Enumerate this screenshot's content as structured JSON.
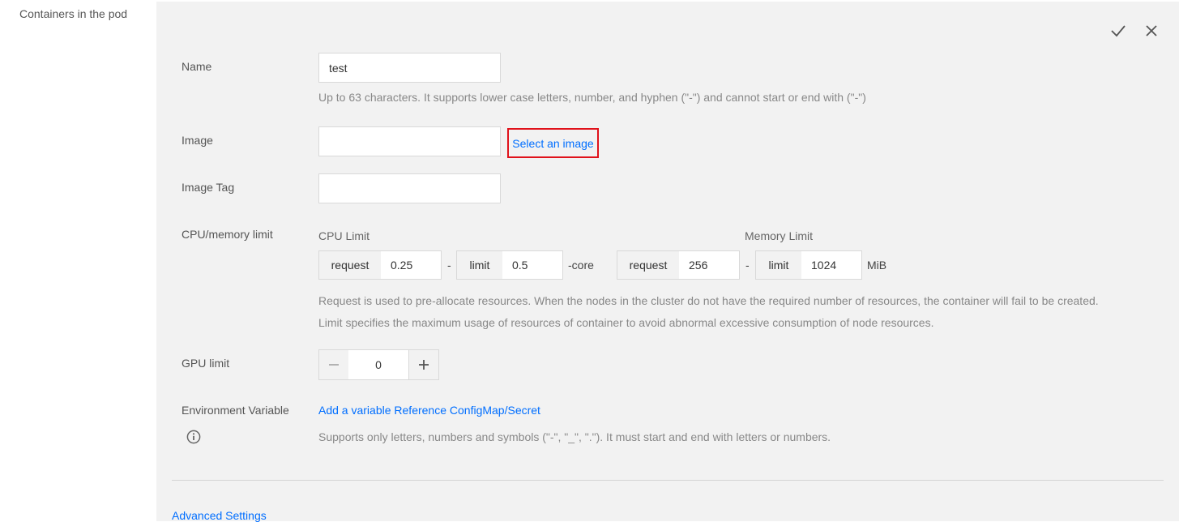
{
  "sidebar": {
    "title": "Containers in the pod"
  },
  "header": {
    "confirm_icon": "check-icon",
    "close_icon": "close-icon"
  },
  "form": {
    "name": {
      "label": "Name",
      "value": "test",
      "hint": "Up to 63 characters. It supports lower case letters, number, and hyphen (\"-\") and cannot start or end with (\"-\")"
    },
    "image": {
      "label": "Image",
      "value": "",
      "select_link": "Select an image"
    },
    "image_tag": {
      "label": "Image Tag",
      "value": ""
    },
    "cpu_memory": {
      "label": "CPU/memory limit",
      "cpu_label": "CPU Limit",
      "memory_label": "Memory Limit",
      "cpu_request_addon": "request",
      "cpu_request_value": "0.25",
      "cpu_limit_addon": "limit",
      "cpu_limit_value": "0.5",
      "cpu_unit": "-core",
      "mem_request_addon": "request",
      "mem_request_value": "256",
      "mem_limit_addon": "limit",
      "mem_limit_value": "1024",
      "mem_unit": "MiB",
      "dash": "-",
      "hint_line1": "Request is used to pre-allocate resources. When the nodes in the cluster do not have the required number of resources, the container will fail to be created.",
      "hint_line2": "Limit specifies the maximum usage of resources of container to avoid abnormal excessive consumption of node resources."
    },
    "gpu": {
      "label": "GPU limit",
      "value": "0"
    },
    "env": {
      "label": "Environment Variable",
      "add_link": "Add a variable",
      "ref_link": "Reference ConfigMap/Secret",
      "hint": "Supports only letters, numbers and symbols (\"-\", \"_\", \".\"). It must start and end with letters or numbers.",
      "info_icon": "info-icon"
    }
  },
  "advanced": {
    "label": "Advanced Settings"
  },
  "colors": {
    "accent": "#006eff",
    "highlight": "#e0121b",
    "panel_bg": "#f2f2f2"
  }
}
